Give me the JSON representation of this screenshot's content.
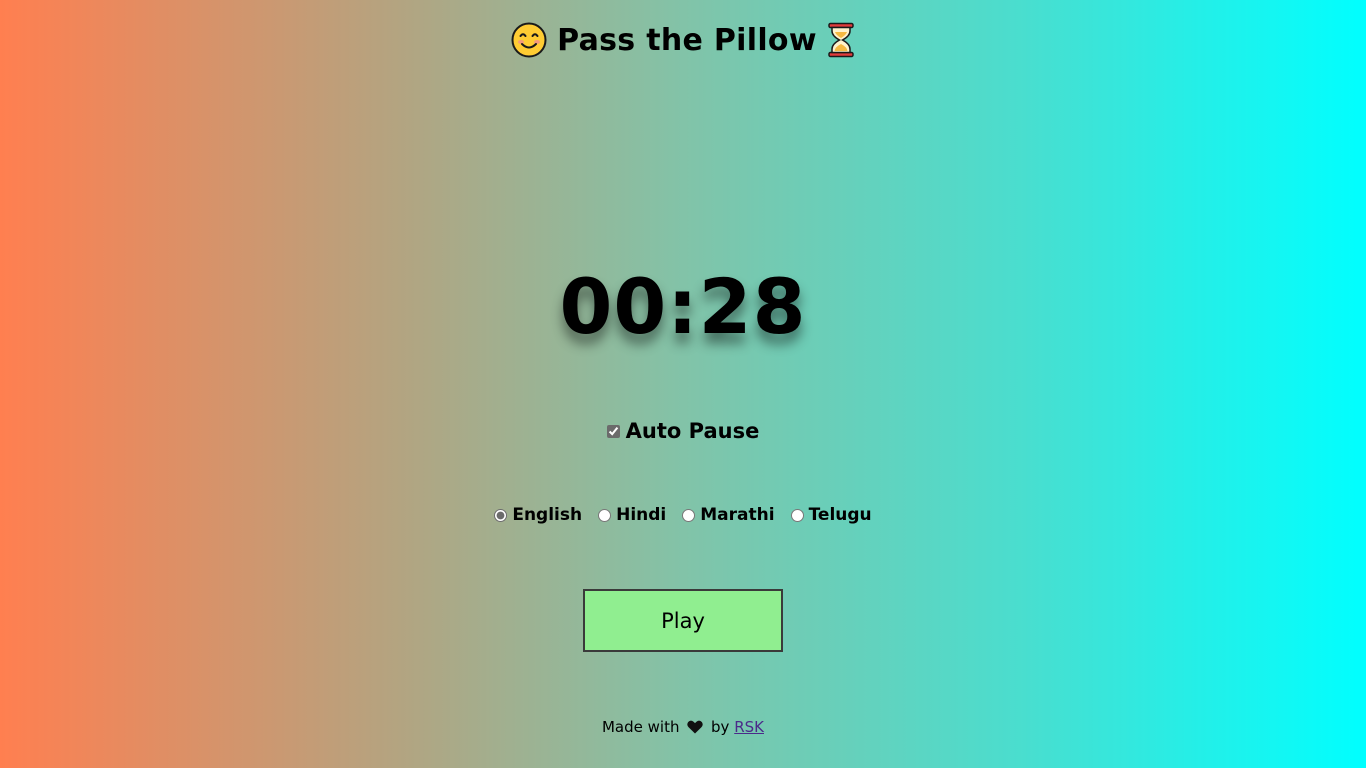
{
  "header": {
    "title": "Pass the Pillow",
    "left_icon": "smiling-face-icon",
    "right_icon": "hourglass-icon"
  },
  "timer": {
    "display": "00:28"
  },
  "auto_pause": {
    "label": "Auto Pause",
    "checked": true
  },
  "languages": {
    "options": [
      {
        "label": "English",
        "selected": true
      },
      {
        "label": "Hindi",
        "selected": false
      },
      {
        "label": "Marathi",
        "selected": false
      },
      {
        "label": "Telugu",
        "selected": false
      }
    ]
  },
  "play_button": {
    "label": "Play",
    "color": "#90ee90"
  },
  "footer": {
    "prefix": "Made with",
    "heart_icon": "heart-icon",
    "by": "by",
    "author_link": "RSK"
  },
  "colors": {
    "gradient_start": "#ff7f50",
    "gradient_end": "#00ffff"
  }
}
